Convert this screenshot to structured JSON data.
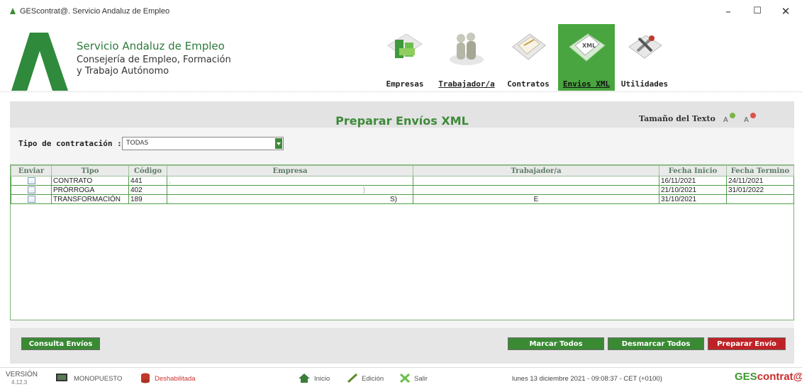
{
  "window": {
    "title": "GEScontrat@. Servicio Andaluz de Empleo",
    "minimize": "–",
    "maximize": "☐",
    "close": "✕"
  },
  "header": {
    "org_name": "Servicio Andaluz de Empleo",
    "org_sub1": "Consejería de Empleo, Formación",
    "org_sub2": "y Trabajo Autónomo"
  },
  "nav": [
    {
      "label": "Empresas",
      "icon": "building-icon",
      "active": false
    },
    {
      "label": "Trabajador/a",
      "icon": "workers-icon",
      "active": false
    },
    {
      "label": "Contratos",
      "icon": "contract-icon",
      "active": false
    },
    {
      "label": "Envios XML",
      "icon": "xml-file-icon",
      "active": true
    },
    {
      "label": "Utilidades",
      "icon": "tools-icon",
      "active": false
    }
  ],
  "page": {
    "title": "Preparar Envíos XML",
    "text_size_label": "Tamaño del Texto",
    "filter_label": "Tipo de contratación :",
    "filter_value": "TODAS"
  },
  "table": {
    "columns": [
      "Enviar",
      "Tipo",
      "Código",
      "Empresa",
      "Trabajador/a",
      "Fecha Inicio",
      "Fecha Termino"
    ],
    "rows": [
      {
        "tipo": "CONTRATO",
        "codigo": "441",
        "empresa": ",",
        "trabajador": "",
        "fecha_inicio": "16/11/2021",
        "fecha_termino": "24/11/2021"
      },
      {
        "tipo": "PRÓRROGA",
        "codigo": "402",
        "empresa": ")",
        "trabajador": "",
        "fecha_inicio": "21/10/2021",
        "fecha_termino": "31/01/2022"
      },
      {
        "tipo": "TRANSFORMACIÓN",
        "codigo": "189",
        "empresa": "S)",
        "trabajador": "E",
        "fecha_inicio": "31/10/2021",
        "fecha_termino": ""
      }
    ]
  },
  "buttons": {
    "consulta": "Consulta Envíos",
    "marcar": "Marcar Todos",
    "desmarcar": "Desmarcar Todos",
    "preparar": "Preparar Envío"
  },
  "status": {
    "version_label": "VERSIÓN",
    "version_num": "4.12.3",
    "mode": "MONOPUESTO",
    "disabled": "Deshabilitada",
    "inicio": "Inicio",
    "edicion": "Edición",
    "salir": "Salir",
    "datetime": "lunes 13 diciembre 2021 - 09:08:37 - CET (+0100)",
    "brand_a": "GES",
    "brand_b": "contrat@"
  },
  "colors": {
    "accent_green": "#3a8a34",
    "danger_red": "#bf2226"
  }
}
